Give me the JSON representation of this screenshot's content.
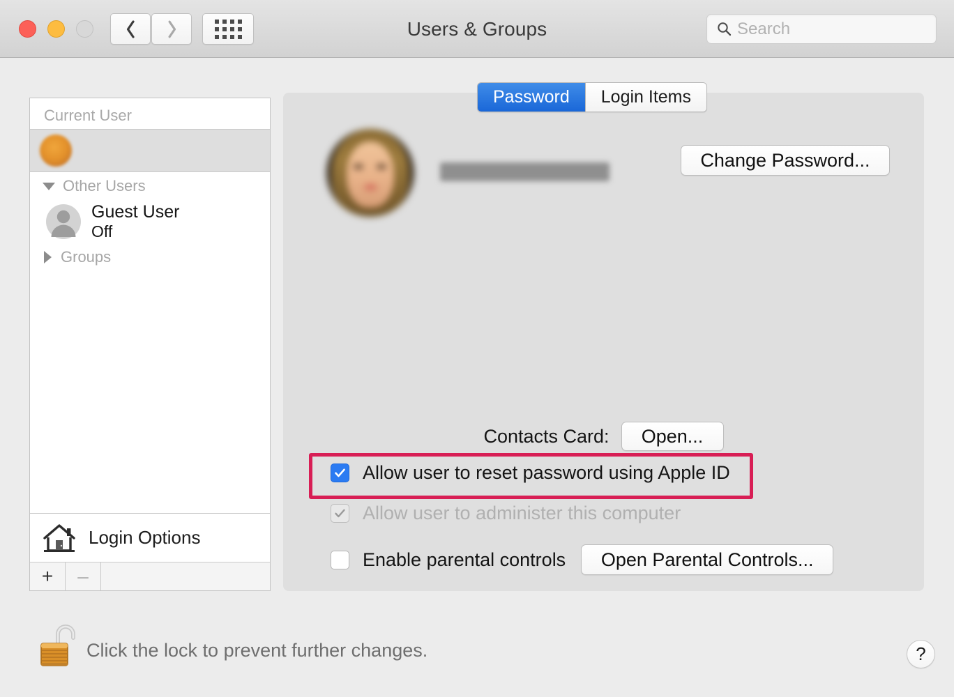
{
  "window": {
    "title": "Users & Groups",
    "traffic_lights": [
      "close",
      "minimize",
      "zoom"
    ],
    "nav_back_icon": "chevron-left-icon",
    "nav_forward_icon": "chevron-right-icon",
    "show_all_icon": "grid-icon"
  },
  "search": {
    "placeholder": "Search",
    "value": "",
    "icon": "search-icon"
  },
  "sidebar": {
    "section_current": "Current User",
    "current_user": {
      "name": "",
      "subtitle": "",
      "redacted": true,
      "avatar_icon": "user-avatar"
    },
    "group_other_users": {
      "label": "Other Users",
      "expanded": true,
      "disclosure_icon": "triangle-down-icon"
    },
    "other_users": [
      {
        "name": "Guest User",
        "state": "Off",
        "icon": "guest-user-icon"
      }
    ],
    "group_groups": {
      "label": "Groups",
      "expanded": false,
      "disclosure_icon": "triangle-right-icon"
    },
    "login_options": {
      "label": "Login Options",
      "icon": "house-icon"
    },
    "add_label": "+",
    "remove_label": "–"
  },
  "main": {
    "tabs": [
      {
        "label": "Password",
        "active": true
      },
      {
        "label": "Login Items",
        "active": false
      }
    ],
    "user_name": "",
    "user_name_redacted": true,
    "change_password_label": "Change Password...",
    "contacts_card_label": "Contacts Card:",
    "contacts_open_label": "Open...",
    "options": [
      {
        "label": "Allow user to reset password using Apple ID",
        "checked": true,
        "enabled": true,
        "highlighted": true
      },
      {
        "label": "Allow user to administer this computer",
        "checked": true,
        "enabled": false,
        "highlighted": false
      },
      {
        "label": "Enable parental controls",
        "checked": false,
        "enabled": true,
        "highlighted": false
      }
    ],
    "open_parental_controls_label": "Open Parental Controls..."
  },
  "footer": {
    "lock_icon": "unlocked-padlock-icon",
    "lock_state": "unlocked",
    "message": "Click the lock to prevent further changes.",
    "help_label": "?"
  },
  "colors": {
    "accent_tab": "#1a67d8",
    "checkbox_checked": "#2b7bf2",
    "highlight_border": "#d81e55",
    "window_bg": "#ececec",
    "panel_bg": "#dfdfdf"
  }
}
